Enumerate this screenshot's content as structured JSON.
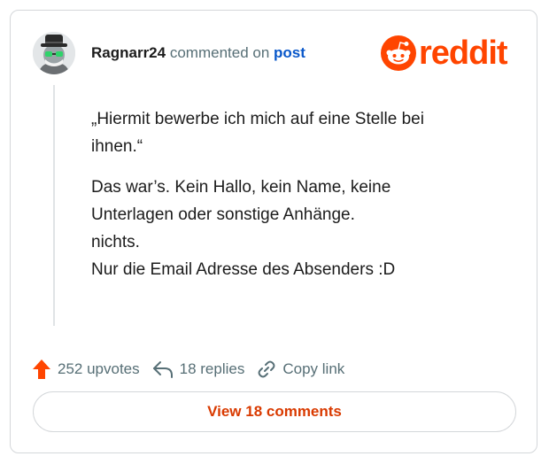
{
  "header": {
    "username": "Ragnarr24",
    "commented_on": "commented on",
    "post_link": "post",
    "logo_text": "reddit"
  },
  "comment": {
    "paragraphs": [
      [
        "„Hiermit bewerbe ich mich auf eine Stelle bei",
        "ihnen.“"
      ],
      [
        "Das war’s. Kein Hallo, kein Name, keine",
        "Unterlagen oder sonstige Anhänge.",
        "nichts.",
        "Nur die Email Adresse des Absenders :D"
      ]
    ]
  },
  "footer": {
    "upvotes": "252 upvotes",
    "replies": "18 replies",
    "copy_link": "Copy link"
  },
  "view_button": "View 18 comments",
  "colors": {
    "brand": "#ff4500",
    "upvote": "#ff4500",
    "link": "#0a58ca",
    "button_text": "#d93a00"
  }
}
